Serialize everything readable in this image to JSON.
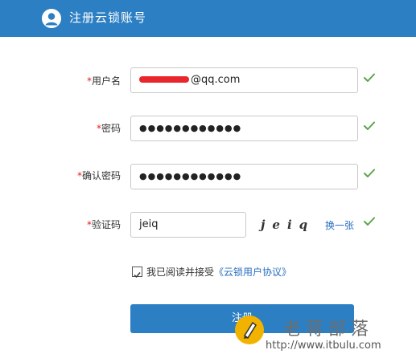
{
  "header": {
    "title": "注册云锁账号",
    "icon": "user-icon"
  },
  "form": {
    "required_mark": "*",
    "username": {
      "label": "用户名",
      "value_suffix": "@qq.com"
    },
    "password": {
      "label": "密码",
      "value": "●●●●●●●●●●●●"
    },
    "confirm": {
      "label": "确认密码",
      "value": "●●●●●●●●●●●●"
    },
    "captcha": {
      "label": "验证码",
      "value": "jeiq",
      "image_text": "jeiq",
      "refresh_label": "换一张"
    },
    "agree": {
      "text": "我已阅读并接受",
      "link": "《云锁用户协议》",
      "checked": true
    },
    "submit_label": "注册"
  },
  "watermark": {
    "title": "老蒋部落",
    "url": "http://www.itbulu.com"
  },
  "colors": {
    "accent": "#2c7fc3",
    "valid": "#5aa64a",
    "required": "#e02020",
    "link": "#2a6fc0"
  }
}
